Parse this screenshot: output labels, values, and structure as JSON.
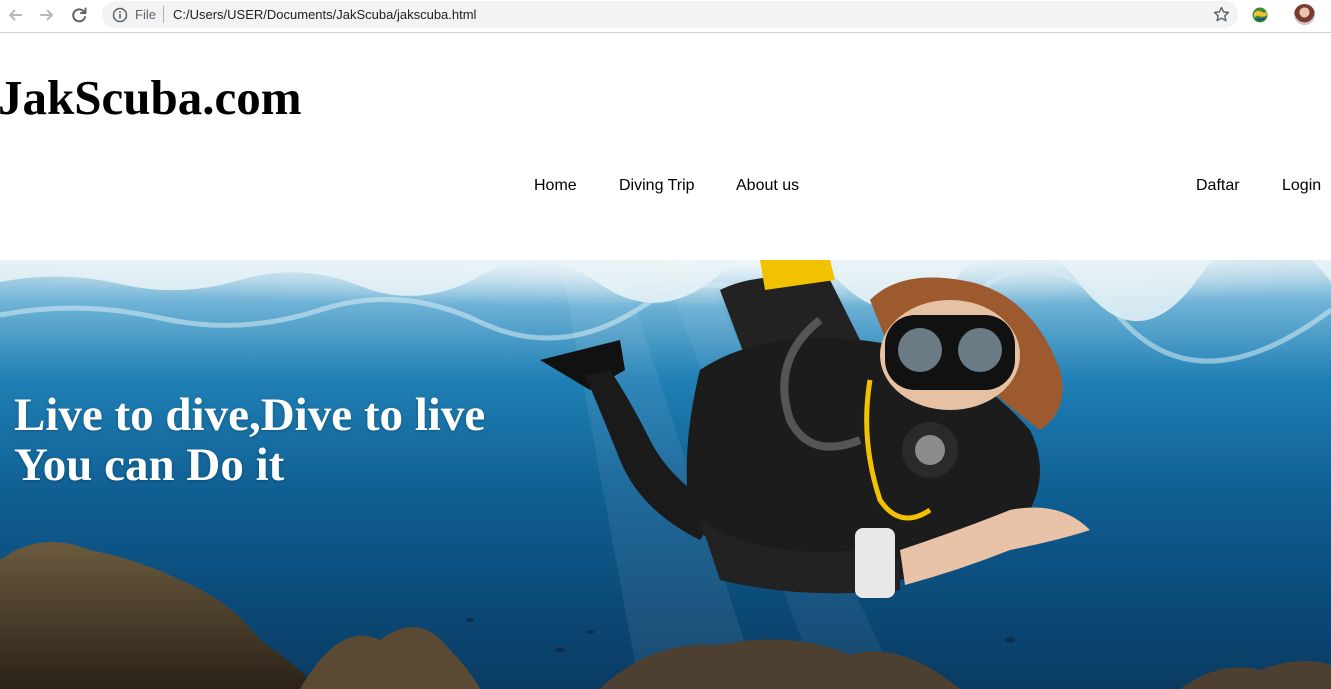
{
  "browser": {
    "scheme_label": "File",
    "address": "C:/Users/USER/Documents/JakScuba/jakscuba.html",
    "icons": [
      "back-arrow-icon",
      "forward-arrow-icon",
      "reload-icon",
      "info-icon",
      "star-icon",
      "extension-icon",
      "profile-avatar"
    ]
  },
  "site": {
    "title": "JakScuba.com"
  },
  "nav": {
    "main": [
      "Home",
      "Diving Trip",
      "About us"
    ],
    "account": [
      "Daftar",
      "Login"
    ]
  },
  "hero": {
    "line1": "Live to dive,Dive to live",
    "line2": "You can Do it"
  },
  "colors": {
    "text": "#000000",
    "hero_text": "#ffffff",
    "water_top": "#cfe4ef",
    "water_deep": "#0a3b62"
  }
}
